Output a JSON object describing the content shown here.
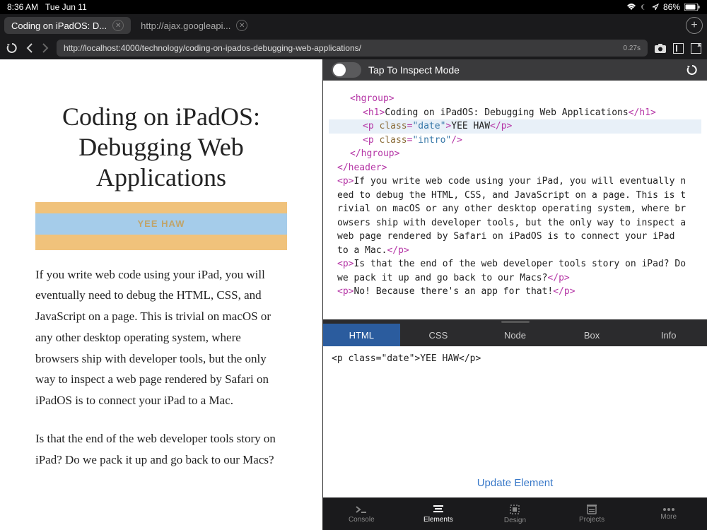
{
  "status": {
    "time": "8:36 AM",
    "date": "Tue Jun 11",
    "battery": "86%"
  },
  "tabs": {
    "t1": "Coding on iPadOS: D...",
    "t2": "http://ajax.googleapi..."
  },
  "url": {
    "value": "http://localhost:4000/technology/coding-on-ipados-debugging-web-applications/",
    "load_time": "0.27s"
  },
  "page": {
    "title": "Coding on iPadOS: Debugging Web Applications",
    "highlight": "YEE HAW",
    "p1": "If you write web code using your iPad, you will eventually need to debug the HTML, CSS, and JavaScript on a page. This is trivial on macOS or any other desktop operating system, where browsers ship with developer tools, but the only way to inspect a web page rendered by Safari on iPadOS is to connect your iPad to a Mac.",
    "p2": "Is that the end of the web developer tools story on iPad? Do we pack it up and go back to our Macs?"
  },
  "inspector": {
    "toggle_label": "Tap To Inspect Mode",
    "tabs": {
      "html": "HTML",
      "css": "CSS",
      "node": "Node",
      "box": "Box",
      "info": "Info"
    },
    "detail_line": "<p class=\"date\">YEE HAW</p>",
    "update_btn": "Update Element",
    "dom": {
      "l1": "<hgroup>",
      "l2_open": "<h1>",
      "l2_txt": "Coding on iPadOS: Debugging Web Applications",
      "l2_close": "</h1>",
      "l3_open": "<p ",
      "l3_an": "class",
      "l3_av": "\"date\"",
      "l3_mid": ">",
      "l3_txt": "YEE HAW",
      "l3_close": "</p>",
      "l4_open": "<p ",
      "l4_an": "class",
      "l4_av": "\"intro\"",
      "l4_close": "/>",
      "l5": "</hgroup>",
      "l6": "</header>",
      "p1_open": "<p>",
      "p1_txt": "If you write web code using your iPad, you will eventually n",
      "p1_b": "eed to debug the HTML, CSS, and JavaScript on a page. This is t",
      "p1_c": "rivial on macOS or any other desktop operating system, where br",
      "p1_d": "owsers ship with developer tools, but the only way to inspect a",
      "p1_e": " web page rendered by Safari on iPadOS is to connect your iPad ",
      "p1_f": "to a Mac.",
      "p1_close": "</p>",
      "p2_open": "<p>",
      "p2_txt": "Is that the end of the web developer tools story on iPad? Do",
      "p2_b": " we pack it up and go back to our Macs?",
      "p2_close": "</p>",
      "p3_open": "<p>",
      "p3_txt": "No! Because there's an app for that!",
      "p3_close": "</p>"
    }
  },
  "bottom_nav": {
    "console": "Console",
    "elements": "Elements",
    "design": "Design",
    "projects": "Projects",
    "more": "More"
  }
}
